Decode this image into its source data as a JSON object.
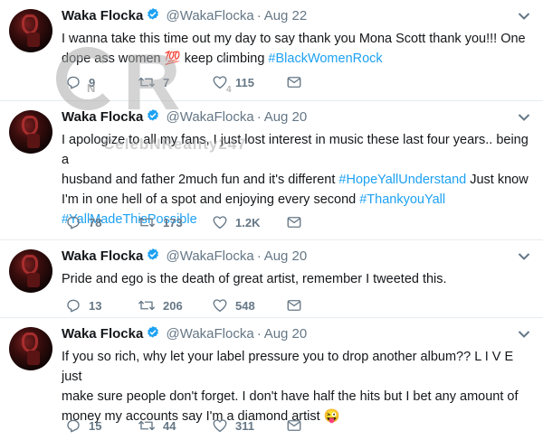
{
  "tweets": [
    {
      "name": "Waka Flocka",
      "handle": "@WakaFlocka",
      "dot": "·",
      "date": "Aug 22",
      "lines": [
        [
          {
            "t": "I wanna take this time out my day to say thank you Mona Scott thank you!!! One"
          }
        ],
        [
          {
            "t": "dope ass women 💯 keep climbing "
          },
          {
            "t": "#BlackWomenRock",
            "h": true
          }
        ]
      ],
      "replies": "9",
      "retweets": "7",
      "likes": "115"
    },
    {
      "name": "Waka Flocka",
      "handle": "@WakaFlocka",
      "dot": "·",
      "date": "Aug 20",
      "lines": [
        [
          {
            "t": "I apologize to all my fans, I just lost interest in music these last four years.. being a"
          }
        ],
        [
          {
            "t": "husband and father 2much fun and it's different "
          },
          {
            "t": "#HopeYallUnderstand",
            "h": true
          },
          {
            "t": "  Just know"
          }
        ],
        [
          {
            "t": "I'm in one hell of a spot and enjoying every second "
          },
          {
            "t": "#ThankyouYall",
            "h": true
          }
        ],
        [
          {
            "t": "#YallMadeThisPossible",
            "h": true
          }
        ]
      ],
      "replies": "78",
      "retweets": "173",
      "likes": "1.2K"
    },
    {
      "name": "Waka Flocka",
      "handle": "@WakaFlocka",
      "dot": "·",
      "date": "Aug 20",
      "lines": [
        [
          {
            "t": "Pride and ego is the death of great artist, remember I tweeted this."
          }
        ]
      ],
      "replies": "13",
      "retweets": "206",
      "likes": "548"
    },
    {
      "name": "Waka Flocka",
      "handle": "@WakaFlocka",
      "dot": "·",
      "date": "Aug 20",
      "lines": [
        [
          {
            "t": "If you so rich, why let your label pressure you to drop another album?? L I V E just"
          }
        ],
        [
          {
            "t": "make sure people don't forget. I don't have half the hits but I bet any amount of"
          }
        ],
        [
          {
            "t": "money my accounts say I'm a diamond artist 😜"
          }
        ]
      ],
      "replies": "15",
      "retweets": "44",
      "likes": "311"
    }
  ],
  "watermark": {
    "text": "CelebNReality247",
    "letters": [
      "C",
      "R",
      "N",
      "2",
      "4"
    ]
  },
  "icons": [
    "verified-icon",
    "chevron-down-icon",
    "reply-icon",
    "retweet-icon",
    "like-icon",
    "share-icon"
  ],
  "colors": {
    "hashtag": "#1da1f2",
    "muted": "#657786",
    "text": "#14171a",
    "divider": "#e6ecf0",
    "verified": "#1da1f2"
  }
}
